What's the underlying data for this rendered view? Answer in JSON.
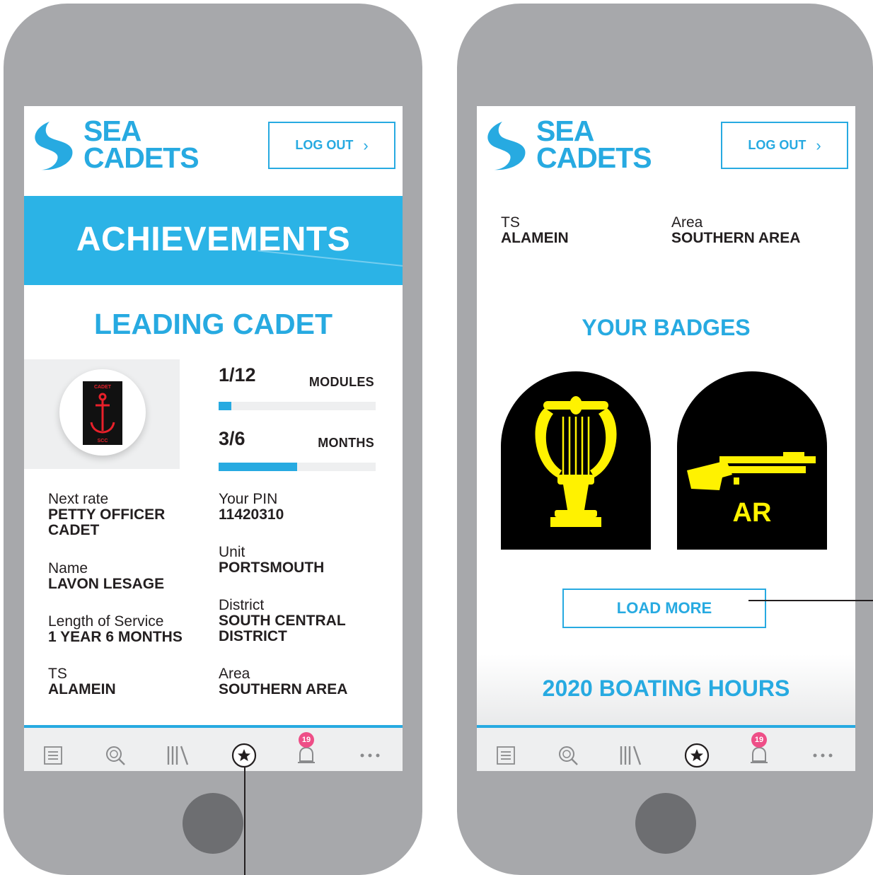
{
  "brand": {
    "line1": "SEA",
    "line2": "CADETS"
  },
  "header": {
    "logout_label": "LOG OUT",
    "logout_chevron": "›"
  },
  "achievements_screen": {
    "banner_title": "ACHIEVEMENTS",
    "rank_title": "LEADING CADET",
    "rank_insignia": {
      "top_text": "CADET",
      "bottom_text": "SCC",
      "icon": "anchor-icon"
    },
    "progress": [
      {
        "value": "1/12",
        "label": "MODULES",
        "fraction": 0.08
      },
      {
        "value": "3/6",
        "label": "MONTHS",
        "fraction": 0.5
      }
    ],
    "details_left": [
      {
        "key": "Next rate",
        "value": "PETTY OFFICER CADET"
      },
      {
        "key": "Name",
        "value": "LAVON LESAGE"
      },
      {
        "key": "Length of Service",
        "value": "1 YEAR 6 MONTHS"
      },
      {
        "key": "TS",
        "value": "ALAMEIN"
      }
    ],
    "details_right": [
      {
        "key": "Your PIN",
        "value": "11420310"
      },
      {
        "key": "Unit",
        "value": "PORTSMOUTH"
      },
      {
        "key": "District",
        "value": "SOUTH CENTRAL DISTRICT"
      },
      {
        "key": "Area",
        "value": "SOUTHERN AREA"
      }
    ]
  },
  "badges_screen": {
    "ts": {
      "key": "TS",
      "value": "ALAMEIN"
    },
    "area": {
      "key": "Area",
      "value": "SOUTHERN AREA"
    },
    "section_title": "YOUR BADGES",
    "badges": [
      {
        "icon": "lyre-icon"
      },
      {
        "icon": "rifle-icon",
        "text": "AR"
      }
    ],
    "load_more_label": "LOAD MORE",
    "boating_title": "2020 BOATING HOURS"
  },
  "tabbar": {
    "items": [
      "list-icon",
      "search-icon",
      "library-icon",
      "star-icon",
      "notifications-icon",
      "more-icon"
    ],
    "notification_count": "19",
    "active": "star-icon"
  },
  "colors": {
    "accent": "#27aae1",
    "frame": "#a7a8ab",
    "home_button": "#6d6e71",
    "badge_yellow": "#fff200",
    "notification": "#ee4e87"
  }
}
